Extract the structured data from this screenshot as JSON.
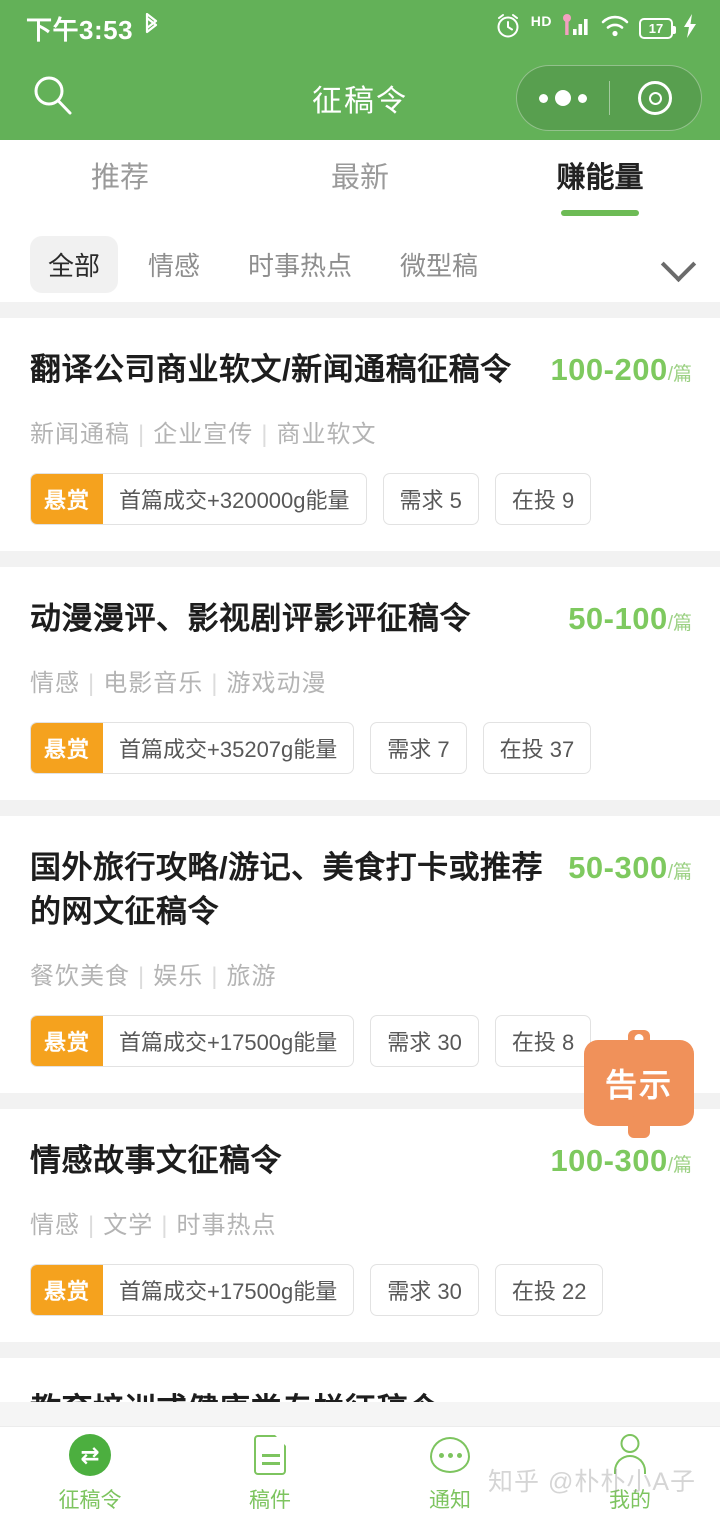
{
  "status_bar": {
    "time": "下午3:53",
    "bluetooth_icon": "bluetooth-icon",
    "alarm_icon": "alarm-icon",
    "hd_label": "HD",
    "signal_icon": "signal-icon",
    "wifi_icon": "wifi-icon",
    "battery_level": "17",
    "charging_icon": "charging-bolt-icon"
  },
  "header": {
    "title": "征稿令",
    "search_icon": "search-icon",
    "capsule": {
      "more_icon": "more-dots-icon",
      "target_icon": "target-circle-icon"
    },
    "background_color": "#63b158"
  },
  "tabs": [
    {
      "label": "推荐",
      "active": false
    },
    {
      "label": "最新",
      "active": false
    },
    {
      "label": "赚能量",
      "active": true
    }
  ],
  "filters": {
    "chips": [
      {
        "label": "全部",
        "selected": true
      },
      {
        "label": "情感",
        "selected": false
      },
      {
        "label": "时事热点",
        "selected": false
      },
      {
        "label": "微型稿",
        "selected": false
      }
    ],
    "expand_icon": "chevron-down-icon"
  },
  "cards": [
    {
      "title": "翻译公司商业软文/新闻通稿征稿令",
      "price": "100-200",
      "price_unit": "/篇",
      "categories": [
        "新闻通稿",
        "企业宣传",
        "商业软文"
      ],
      "bounty_badge": "悬赏",
      "bounty_text": "首篇成交+320000g能量",
      "demand": "需求 5",
      "bidding": "在投 9"
    },
    {
      "title": "动漫漫评、影视剧评影评征稿令",
      "price": "50-100",
      "price_unit": "/篇",
      "categories": [
        "情感",
        "电影音乐",
        "游戏动漫"
      ],
      "bounty_badge": "悬赏",
      "bounty_text": "首篇成交+35207g能量",
      "demand": "需求 7",
      "bidding": "在投 37"
    },
    {
      "title": "国外旅行攻略/游记、美食打卡或推荐的网文征稿令",
      "price": "50-300",
      "price_unit": "/篇",
      "categories": [
        "餐饮美食",
        "娱乐",
        "旅游"
      ],
      "bounty_badge": "悬赏",
      "bounty_text": "首篇成交+17500g能量",
      "demand": "需求 30",
      "bidding": "在投 8"
    },
    {
      "title": "情感故事文征稿令",
      "price": "100-300",
      "price_unit": "/篇",
      "categories": [
        "情感",
        "文学",
        "时事热点"
      ],
      "bounty_badge": "悬赏",
      "bounty_text": "首篇成交+17500g能量",
      "demand": "需求 30",
      "bidding": "在投 22"
    },
    {
      "title": "教育培训或健康类专栏征稿令",
      "price": "",
      "price_unit": "",
      "categories": [],
      "bounty_badge": "",
      "bounty_text": "",
      "demand": "",
      "bidding": ""
    }
  ],
  "floating_button": {
    "label": "告示",
    "icon": "notice-board-icon",
    "color": "#f0915a"
  },
  "bottom_nav": [
    {
      "label": "征稿令",
      "icon": "submission-order-icon",
      "active": true
    },
    {
      "label": "稿件",
      "icon": "document-icon",
      "active": false
    },
    {
      "label": "通知",
      "icon": "notification-bubble-icon",
      "active": false
    },
    {
      "label": "我的",
      "icon": "person-icon",
      "active": false
    }
  ],
  "watermark": "知乎 @朴朴小A子"
}
